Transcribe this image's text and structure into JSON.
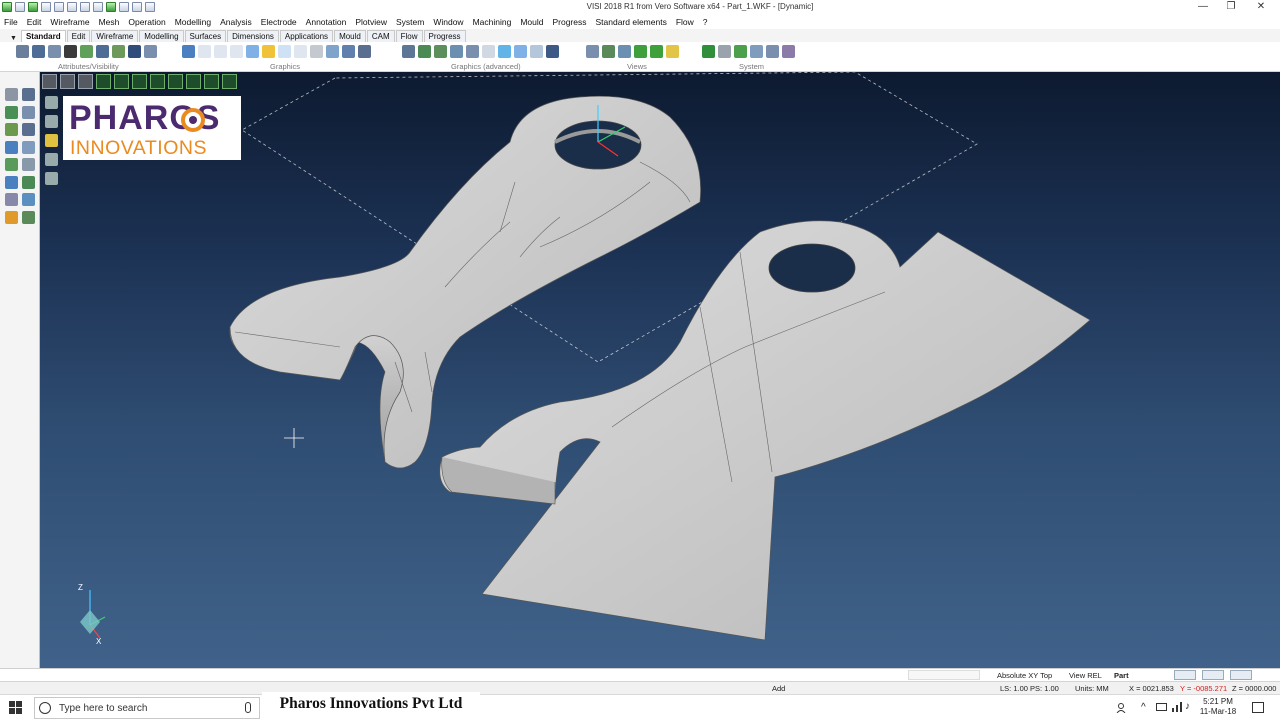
{
  "window": {
    "title": "VISI 2018 R1 from Vero Software x64 - Part_1.WKF - [Dynamic]",
    "minimize_glyph": "—",
    "restore_glyph": "❐",
    "close_glyph": "✕"
  },
  "menu": [
    "File",
    "Edit",
    "Wireframe",
    "Mesh",
    "Operation",
    "Modelling",
    "Analysis",
    "Electrode",
    "Annotation",
    "Plotview",
    "System",
    "Window",
    "Machining",
    "Mould",
    "Progress",
    "Standard elements",
    "Flow",
    "?"
  ],
  "tabs": [
    {
      "label": "Standard",
      "active": true
    },
    {
      "label": "Edit"
    },
    {
      "label": "Wireframe"
    },
    {
      "label": "Modelling"
    },
    {
      "label": "Surfaces"
    },
    {
      "label": "Dimensions"
    },
    {
      "label": "Applications"
    },
    {
      "label": "Mould"
    },
    {
      "label": "CAM"
    },
    {
      "label": "Flow"
    },
    {
      "label": "Progress"
    }
  ],
  "toolbar_groups": {
    "attributes": "Attributes/Visibility",
    "graphics": "Graphics",
    "graphics_advanced": "Graphics (advanced)",
    "views": "Views",
    "system": "System"
  },
  "logo": {
    "line1": "PHAROS",
    "line2": "INNOVATIONS",
    "brand_purple": "#4b2a6f",
    "brand_orange": "#e98b21"
  },
  "axis": {
    "z_label": "Z",
    "x_label": "X"
  },
  "status": {
    "view_mode": "Absolute XY Top",
    "view_rel": "View REL",
    "part": "Part",
    "add": "Add",
    "ls_ps": "LS: 1.00 PS: 1.00",
    "units": "Units: MM",
    "coords_x": "X = 0021.853",
    "coords_y": "Y = -0085.271",
    "coords_z": "Z = 0000.000"
  },
  "taskbar": {
    "search_placeholder": "Type here to search",
    "company": "Pharos Innovations Pvt Ltd",
    "time": "5:21 PM",
    "date": "11-Mar-18"
  },
  "colors": {
    "viewport_top": "#0d1a30",
    "viewport_bottom": "#40628a",
    "part_surface": "#c9c9c9"
  }
}
